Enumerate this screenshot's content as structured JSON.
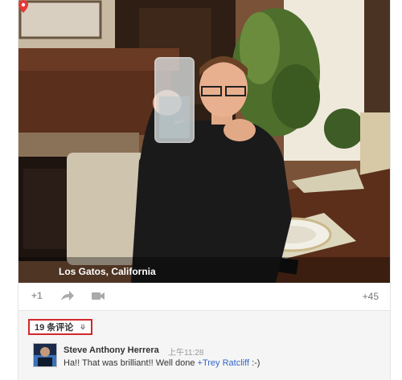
{
  "post": {
    "location": "Los Gatos, California",
    "plus_one_label": "+1",
    "plus_count": "+45"
  },
  "comments": {
    "count_label": "19 条评论",
    "items": [
      {
        "author": "Steve Anthony Herrera",
        "time": "上午11:28",
        "text_before": "Ha!! That was brilliant!! Well done ",
        "mention": "+Trey Ratcliff",
        "text_after": " :-)"
      }
    ]
  },
  "icons": {
    "location": "map-pin-icon",
    "share": "share-arrow-icon",
    "hangout": "video-camera-icon",
    "expand": "chevron-down-icon"
  },
  "colors": {
    "pin": "#e53935",
    "highlight_border": "#d0282b",
    "mention": "#3366cc"
  }
}
